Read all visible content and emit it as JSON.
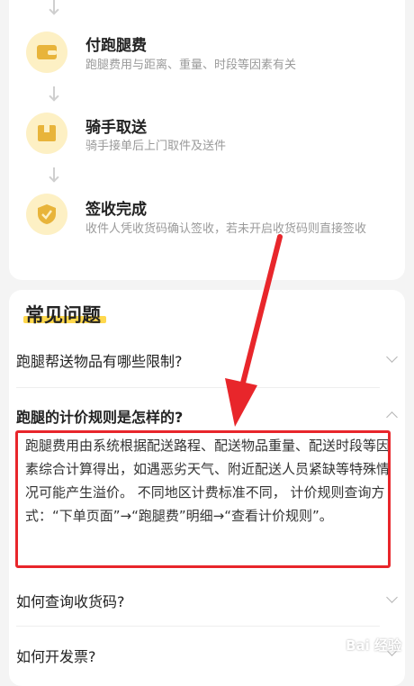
{
  "steps": [
    {
      "icon": "wallet-icon",
      "title": "付跑腿费",
      "desc": "跑腿费用与距离、重量、时段等因素有关"
    },
    {
      "icon": "package-icon",
      "title": "骑手取送",
      "desc": "骑手接单后上门取件及送件"
    },
    {
      "icon": "shield-check-icon",
      "title": "签收完成",
      "desc": "收件人凭收货码确认签收，若未开启收货码则直接签收"
    }
  ],
  "faq": {
    "title": "常见问题",
    "items": [
      {
        "question": "跑腿帮送物品有哪些限制?",
        "expanded": false
      },
      {
        "question": "跑腿的计价规则是怎样的?",
        "expanded": true,
        "answer": "跑腿费用由系统根据配送路程、配送物品重量、配送时段等因素综合计算得出，如遇恶劣天气、附近配送人员紧缺等特殊情况可能产生溢价。 不同地区计费标准不同， 计价规则查询方式：“下单页面”→“跑腿费”明细→“查看计价规则”。"
      },
      {
        "question": "如何查询收货码?",
        "expanded": false
      },
      {
        "question": "如何开发票?",
        "expanded": false
      }
    ]
  },
  "colors": {
    "accent": "#ffd84d",
    "icon_bg": "#fdf0c4",
    "icon_fg": "#e8b43a",
    "annotation": "#e8262b"
  },
  "watermark": "Bai 经验"
}
